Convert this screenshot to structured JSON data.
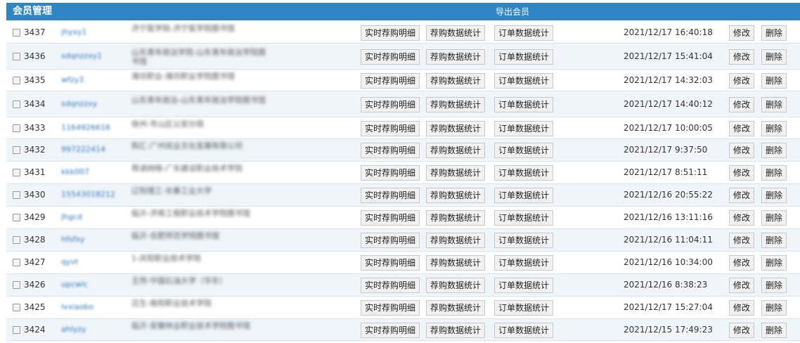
{
  "header": {
    "title": "会员管理",
    "export_label": "导出会员"
  },
  "buttons": {
    "realtime_detail": "实时荐购明细",
    "recommend_stats": "荐购数据统计",
    "order_stats": "订单数据统计",
    "edit": "修改",
    "delete": "删除"
  },
  "rows": [
    {
      "id": "3437",
      "username": "jhyxy1",
      "org": "济宁医学院-济宁医学院图书馆",
      "time": "2021/12/17 16:40:18"
    },
    {
      "id": "3436",
      "username": "sdqnzzxy1",
      "org": "山东青年政治学院-山东青年政治学院图书馆",
      "time": "2021/12/17 15:41:04"
    },
    {
      "id": "3435",
      "username": "wfzy3",
      "org": "潍坊职业-潍坊职业学院图书馆",
      "time": "2021/12/17 14:32:03"
    },
    {
      "id": "3434",
      "username": "sdqnzzxy",
      "org": "山东青年政治-山东青年政治学院图书馆",
      "time": "2021/12/17 14:40:12"
    },
    {
      "id": "3433",
      "username": "1164926616",
      "org": "徐州-市山区公安分局",
      "time": "2021/12/17 10:00:05"
    },
    {
      "id": "3432",
      "username": "997222414",
      "org": "购汇-广州尚业文化发展有限公司",
      "time": "2021/12/17 9:37:50"
    },
    {
      "id": "3431",
      "username": "kkk007",
      "org": "荐读网络-广东建设职业技术学院",
      "time": "2021/12/17 8:51:11"
    },
    {
      "id": "3430",
      "username": "15543018212",
      "org": "辽阳理工-长春工业大学",
      "time": "2021/12/16 20:55:22"
    },
    {
      "id": "3429",
      "username": "jhgcd",
      "org": "临沂-济南工程职业技术学院图书馆",
      "time": "2021/12/16 13:11:16"
    },
    {
      "id": "3428",
      "username": "hfsfxy",
      "org": "临沂-合肥师范学院图书馆",
      "time": "2021/12/16 11:04:11"
    },
    {
      "id": "3427",
      "username": "qyvt",
      "org": "1-庆阳职业技术学院",
      "time": "2021/12/16 10:34:00"
    },
    {
      "id": "3426",
      "username": "upcwlc",
      "org": "王然-中国石油大学（华东）",
      "time": "2021/12/16 8:38:23"
    },
    {
      "id": "3425",
      "username": "lvxiaobo",
      "org": "吕生-南阳职业技术学院",
      "time": "2021/12/17 15:27:04"
    },
    {
      "id": "3424",
      "username": "ahlyzy",
      "org": "临沂-安徽林业职业技术学院图书馆",
      "time": "2021/12/15 17:49:23"
    }
  ]
}
